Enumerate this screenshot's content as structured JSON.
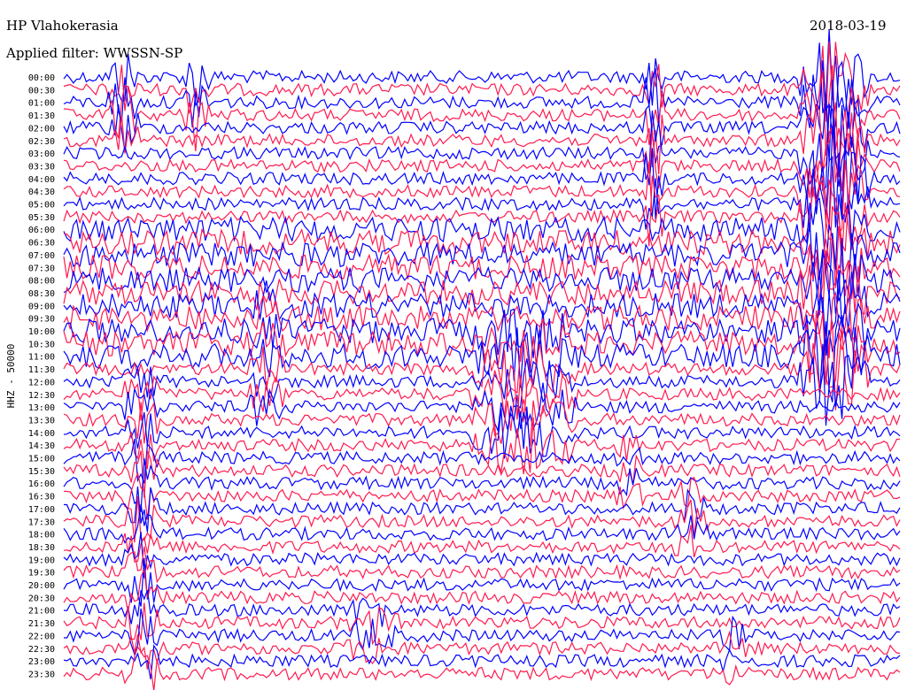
{
  "chart_data": {
    "type": "line",
    "title": "HP Vlahokerasia",
    "subtitle": "Applied filter: WWSSN-SP",
    "date": "2018-03-19",
    "ylabel": "HHZ - 50000",
    "row_labels": [
      "00:00",
      "00:30",
      "01:00",
      "01:30",
      "02:00",
      "02:30",
      "03:00",
      "03:30",
      "04:00",
      "04:30",
      "05:00",
      "05:30",
      "06:00",
      "06:30",
      "07:00",
      "07:30",
      "08:00",
      "08:30",
      "09:00",
      "09:30",
      "10:00",
      "10:30",
      "11:00",
      "11:30",
      "12:00",
      "12:30",
      "13:00",
      "13:30",
      "14:00",
      "14:30",
      "15:00",
      "15:30",
      "16:00",
      "16:30",
      "17:00",
      "17:30",
      "18:00",
      "18:30",
      "19:00",
      "19:30",
      "20:00",
      "20:30",
      "21:00",
      "21:30",
      "22:00",
      "22:30",
      "23:00",
      "23:30"
    ],
    "series_colors": [
      "#0000ff",
      "#ff1a4f"
    ],
    "grid": false
  }
}
